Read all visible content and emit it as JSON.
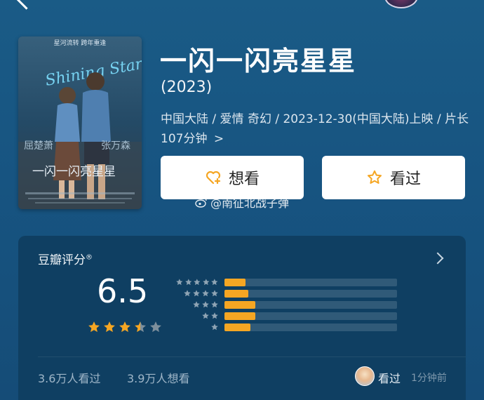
{
  "movie": {
    "title": "一闪一闪亮星星",
    "year": "(2023)",
    "meta": "中国大陆 / 爱情 奇幻 / 2023-12-30(中国大陆)上映 / 片长107分钟",
    "meta_arrow": ">"
  },
  "poster": {
    "tagline": "星河流转 跨年重逢",
    "script_text": "Shining Star",
    "actor_left": "屈楚萧",
    "actor_right": "张万森",
    "title_text": "一闪一闪亮星星"
  },
  "actions": {
    "want_label": "想看",
    "seen_label": "看过"
  },
  "watermark": {
    "text": "@南征北战子弹"
  },
  "rating": {
    "title": "豆瓣评分",
    "title_mark": "®",
    "score": "6.5",
    "score_stars": 3.5,
    "distribution": [
      {
        "stars": 5,
        "fraction": 0.12
      },
      {
        "stars": 4,
        "fraction": 0.14
      },
      {
        "stars": 3,
        "fraction": 0.18
      },
      {
        "stars": 2,
        "fraction": 0.18
      },
      {
        "stars": 1,
        "fraction": 0.15
      }
    ],
    "seen_count": "3.6万人看过",
    "want_count": "3.9万人想看",
    "friend_action": "看过",
    "friend_time": "1分钟前"
  },
  "colors": {
    "accent": "#f5a623",
    "background": "#18557f",
    "card": "#0f3f62"
  },
  "icons": {
    "want": "heart-plus-icon",
    "seen": "star-outline-icon",
    "weibo": "weibo-icon",
    "more": "chevron-right-icon",
    "back": "chevron-left-icon"
  }
}
